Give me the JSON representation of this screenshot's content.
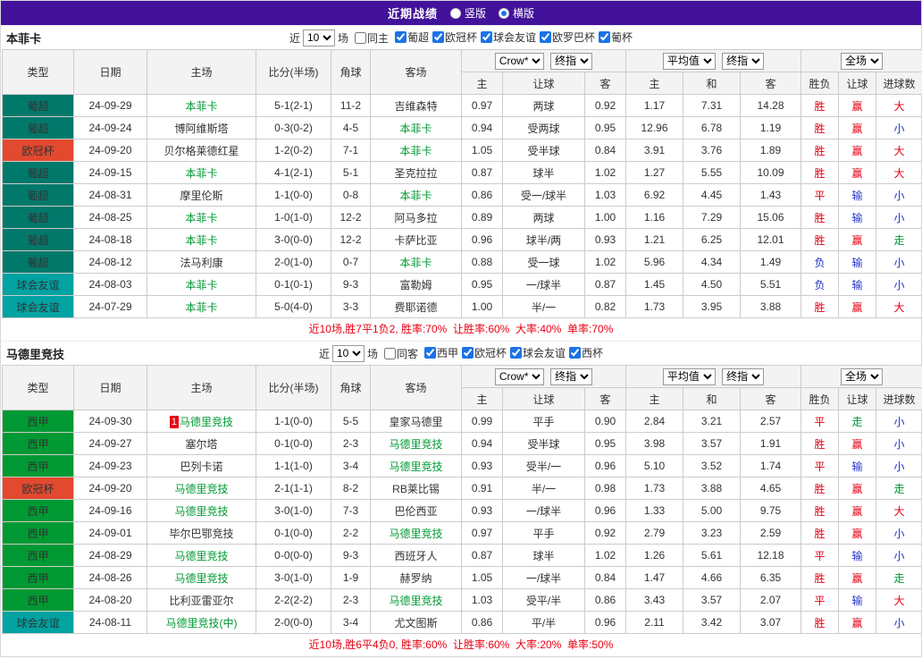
{
  "titlebar": {
    "title": "近期战绩",
    "vertical_label": "竖版",
    "horizontal_label": "横版",
    "selected_mode": "横版"
  },
  "header": {
    "type": "类型",
    "date": "日期",
    "home": "主场",
    "score": "比分(半场)",
    "corner": "角球",
    "away": "客场",
    "odds_source": "Crow*",
    "final_odds": "终指",
    "average": "平均值",
    "final_odds2": "终指",
    "full": "全场",
    "sub_home": "主",
    "sub_handicap": "让球",
    "sub_away": "客",
    "sub_avg_home": "主",
    "sub_draw": "和",
    "sub_avg_away": "客",
    "sub_result": "胜负",
    "sub_hresult": "让球",
    "sub_goals": "进球数"
  },
  "colors": {
    "topbar_bg": "#42129b",
    "score": "#e60012",
    "focal_team": "#009933",
    "summary": "#e60012"
  },
  "league_colors": {
    "葡超": "#00796b",
    "欧冠杯": "#e2492f",
    "球会友谊": "#00a2a2",
    "西甲": "#009933"
  },
  "result_colors": {
    "胜": "#e60012",
    "平": "#e60012",
    "负": "#2233cc",
    "赢": "#e60012",
    "输": "#2233cc",
    "走": "#009933",
    "大": "#e60012",
    "小": "#2233cc"
  },
  "sections": [
    {
      "team": "本菲卡",
      "filter": {
        "prefix": "近",
        "count": "10",
        "suffix": "场",
        "same_label": "同主",
        "leagues": [
          "葡超",
          "欧冠杯",
          "球会友谊",
          "欧罗巴杯",
          "葡杯"
        ]
      },
      "rows": [
        {
          "league": "葡超",
          "date": "24-09-29",
          "home": "本菲卡",
          "home_focal": true,
          "score": "5-1(2-1)",
          "corner": "11-2",
          "away": "吉维森特",
          "away_focal": false,
          "w1": "0.97",
          "handicap": "两球",
          "w2": "0.92",
          "avg_home": "1.17",
          "avg_draw": "7.31",
          "avg_away": "14.28",
          "res": "胜",
          "res_handicap": "赢",
          "res_goals": "大"
        },
        {
          "league": "葡超",
          "date": "24-09-24",
          "home": "博阿维斯塔",
          "home_focal": false,
          "score": "0-3(0-2)",
          "corner": "4-5",
          "away": "本菲卡",
          "away_focal": true,
          "w1": "0.94",
          "handicap": "受两球",
          "w2": "0.95",
          "avg_home": "12.96",
          "avg_draw": "6.78",
          "avg_away": "1.19",
          "res": "胜",
          "res_handicap": "赢",
          "res_goals": "小"
        },
        {
          "league": "欧冠杯",
          "date": "24-09-20",
          "home": "贝尔格莱德红星",
          "home_focal": false,
          "score": "1-2(0-2)",
          "corner": "7-1",
          "away": "本菲卡",
          "away_focal": true,
          "w1": "1.05",
          "handicap": "受半球",
          "w2": "0.84",
          "avg_home": "3.91",
          "avg_draw": "3.76",
          "avg_away": "1.89",
          "res": "胜",
          "res_handicap": "赢",
          "res_goals": "大"
        },
        {
          "league": "葡超",
          "date": "24-09-15",
          "home": "本菲卡",
          "home_focal": true,
          "score": "4-1(2-1)",
          "corner": "5-1",
          "away": "圣克拉拉",
          "away_focal": false,
          "w1": "0.87",
          "handicap": "球半",
          "w2": "1.02",
          "avg_home": "1.27",
          "avg_draw": "5.55",
          "avg_away": "10.09",
          "res": "胜",
          "res_handicap": "赢",
          "res_goals": "大"
        },
        {
          "league": "葡超",
          "date": "24-08-31",
          "home": "摩里伦斯",
          "home_focal": false,
          "score": "1-1(0-0)",
          "corner": "0-8",
          "away": "本菲卡",
          "away_focal": true,
          "w1": "0.86",
          "handicap": "受一/球半",
          "w2": "1.03",
          "avg_home": "6.92",
          "avg_draw": "4.45",
          "avg_away": "1.43",
          "res": "平",
          "res_handicap": "输",
          "res_goals": "小"
        },
        {
          "league": "葡超",
          "date": "24-08-25",
          "home": "本菲卡",
          "home_focal": true,
          "score": "1-0(1-0)",
          "corner": "12-2",
          "away": "阿马多拉",
          "away_focal": false,
          "w1": "0.89",
          "handicap": "两球",
          "w2": "1.00",
          "avg_home": "1.16",
          "avg_draw": "7.29",
          "avg_away": "15.06",
          "res": "胜",
          "res_handicap": "输",
          "res_goals": "小"
        },
        {
          "league": "葡超",
          "date": "24-08-18",
          "home": "本菲卡",
          "home_focal": true,
          "score": "3-0(0-0)",
          "corner": "12-2",
          "away": "卡萨比亚",
          "away_focal": false,
          "w1": "0.96",
          "handicap": "球半/两",
          "w2": "0.93",
          "avg_home": "1.21",
          "avg_draw": "6.25",
          "avg_away": "12.01",
          "res": "胜",
          "res_handicap": "赢",
          "res_goals": "走"
        },
        {
          "league": "葡超",
          "date": "24-08-12",
          "home": "法马利康",
          "home_focal": false,
          "score": "2-0(1-0)",
          "corner": "0-7",
          "away": "本菲卡",
          "away_focal": true,
          "w1": "0.88",
          "handicap": "受一球",
          "w2": "1.02",
          "avg_home": "5.96",
          "avg_draw": "4.34",
          "avg_away": "1.49",
          "res": "负",
          "res_handicap": "输",
          "res_goals": "小"
        },
        {
          "league": "球会友谊",
          "date": "24-08-03",
          "home": "本菲卡",
          "home_focal": true,
          "score": "0-1(0-1)",
          "corner": "9-3",
          "away": "富勒姆",
          "away_focal": false,
          "w1": "0.95",
          "handicap": "一/球半",
          "w2": "0.87",
          "avg_home": "1.45",
          "avg_draw": "4.50",
          "avg_away": "5.51",
          "res": "负",
          "res_handicap": "输",
          "res_goals": "小"
        },
        {
          "league": "球会友谊",
          "date": "24-07-29",
          "home": "本菲卡",
          "home_focal": true,
          "score": "5-0(4-0)",
          "corner": "3-3",
          "away": "费耶诺德",
          "away_focal": false,
          "w1": "1.00",
          "handicap": "半/一",
          "w2": "0.82",
          "avg_home": "1.73",
          "avg_draw": "3.95",
          "avg_away": "3.88",
          "res": "胜",
          "res_handicap": "赢",
          "res_goals": "大"
        }
      ],
      "summary": "近10场,胜7平1负2, 胜率:70%  让胜率:60%  大率:40%  单率:70%"
    },
    {
      "team": "马德里竞技",
      "filter": {
        "prefix": "近",
        "count": "10",
        "suffix": "场",
        "same_label": "同客",
        "leagues": [
          "西甲",
          "欧冠杯",
          "球会友谊",
          "西杯"
        ]
      },
      "rows": [
        {
          "league": "西甲",
          "date": "24-09-30",
          "home": "马德里竞技",
          "home_focal": true,
          "rank": "1",
          "score": "1-1(0-0)",
          "corner": "5-5",
          "away": "皇家马德里",
          "away_focal": false,
          "w1": "0.99",
          "handicap": "平手",
          "w2": "0.90",
          "avg_home": "2.84",
          "avg_draw": "3.21",
          "avg_away": "2.57",
          "res": "平",
          "res_handicap": "走",
          "res_goals": "小"
        },
        {
          "league": "西甲",
          "date": "24-09-27",
          "home": "塞尔塔",
          "home_focal": false,
          "score": "0-1(0-0)",
          "corner": "2-3",
          "away": "马德里竞技",
          "away_focal": true,
          "w1": "0.94",
          "handicap": "受半球",
          "w2": "0.95",
          "avg_home": "3.98",
          "avg_draw": "3.57",
          "avg_away": "1.91",
          "res": "胜",
          "res_handicap": "赢",
          "res_goals": "小"
        },
        {
          "league": "西甲",
          "date": "24-09-23",
          "home": "巴列卡诺",
          "home_focal": false,
          "score": "1-1(1-0)",
          "corner": "3-4",
          "away": "马德里竞技",
          "away_focal": true,
          "w1": "0.93",
          "handicap": "受半/一",
          "w2": "0.96",
          "avg_home": "5.10",
          "avg_draw": "3.52",
          "avg_away": "1.74",
          "res": "平",
          "res_handicap": "输",
          "res_goals": "小"
        },
        {
          "league": "欧冠杯",
          "date": "24-09-20",
          "home": "马德里竞技",
          "home_focal": true,
          "score": "2-1(1-1)",
          "corner": "8-2",
          "away": "RB莱比锡",
          "away_focal": false,
          "w1": "0.91",
          "handicap": "半/一",
          "w2": "0.98",
          "avg_home": "1.73",
          "avg_draw": "3.88",
          "avg_away": "4.65",
          "res": "胜",
          "res_handicap": "赢",
          "res_goals": "走"
        },
        {
          "league": "西甲",
          "date": "24-09-16",
          "home": "马德里竞技",
          "home_focal": true,
          "score": "3-0(1-0)",
          "corner": "7-3",
          "away": "巴伦西亚",
          "away_focal": false,
          "w1": "0.93",
          "handicap": "一/球半",
          "w2": "0.96",
          "avg_home": "1.33",
          "avg_draw": "5.00",
          "avg_away": "9.75",
          "res": "胜",
          "res_handicap": "赢",
          "res_goals": "大"
        },
        {
          "league": "西甲",
          "date": "24-09-01",
          "home": "毕尔巴鄂竞技",
          "home_focal": false,
          "score": "0-1(0-0)",
          "corner": "2-2",
          "away": "马德里竞技",
          "away_focal": true,
          "w1": "0.97",
          "handicap": "平手",
          "w2": "0.92",
          "avg_home": "2.79",
          "avg_draw": "3.23",
          "avg_away": "2.59",
          "res": "胜",
          "res_handicap": "赢",
          "res_goals": "小"
        },
        {
          "league": "西甲",
          "date": "24-08-29",
          "home": "马德里竞技",
          "home_focal": true,
          "score": "0-0(0-0)",
          "corner": "9-3",
          "away": "西班牙人",
          "away_focal": false,
          "w1": "0.87",
          "handicap": "球半",
          "w2": "1.02",
          "avg_home": "1.26",
          "avg_draw": "5.61",
          "avg_away": "12.18",
          "res": "平",
          "res_handicap": "输",
          "res_goals": "小"
        },
        {
          "league": "西甲",
          "date": "24-08-26",
          "home": "马德里竞技",
          "home_focal": true,
          "score": "3-0(1-0)",
          "corner": "1-9",
          "away": "赫罗纳",
          "away_focal": false,
          "w1": "1.05",
          "handicap": "一/球半",
          "w2": "0.84",
          "avg_home": "1.47",
          "avg_draw": "4.66",
          "avg_away": "6.35",
          "res": "胜",
          "res_handicap": "赢",
          "res_goals": "走"
        },
        {
          "league": "西甲",
          "date": "24-08-20",
          "home": "比利亚雷亚尔",
          "home_focal": false,
          "score": "2-2(2-2)",
          "corner": "2-3",
          "away": "马德里竞技",
          "away_focal": true,
          "w1": "1.03",
          "handicap": "受平/半",
          "w2": "0.86",
          "avg_home": "3.43",
          "avg_draw": "3.57",
          "avg_away": "2.07",
          "res": "平",
          "res_handicap": "输",
          "res_goals": "大"
        },
        {
          "league": "球会友谊",
          "date": "24-08-11",
          "home": "马德里竞技(中)",
          "home_focal": true,
          "score": "2-0(0-0)",
          "corner": "3-4",
          "away": "尤文图斯",
          "away_focal": false,
          "w1": "0.86",
          "handicap": "平/半",
          "w2": "0.96",
          "avg_home": "2.11",
          "avg_draw": "3.42",
          "avg_away": "3.07",
          "res": "胜",
          "res_handicap": "赢",
          "res_goals": "小"
        }
      ],
      "summary": "近10场,胜6平4负0, 胜率:60%  让胜率:60%  大率:20%  单率:50%"
    }
  ]
}
